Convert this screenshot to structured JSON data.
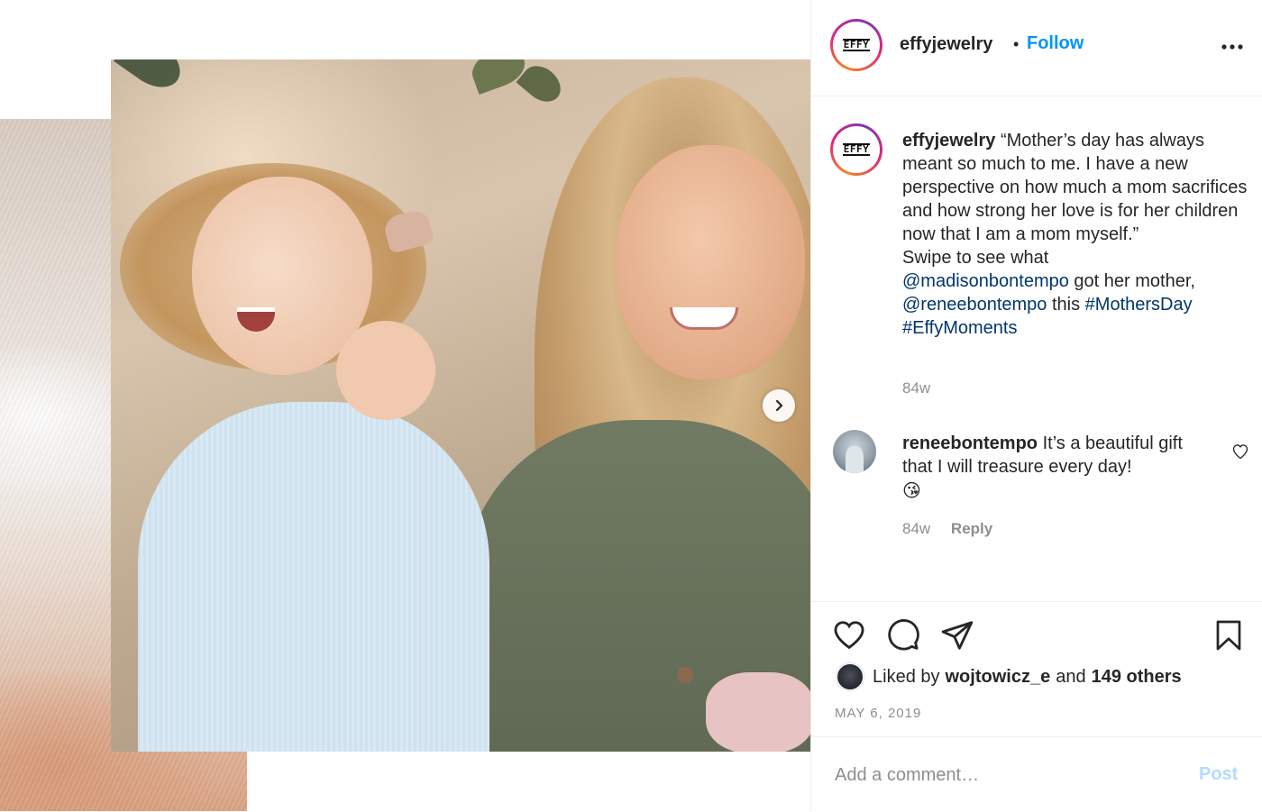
{
  "colors": {
    "link": "#00376b",
    "follow": "#0095f6",
    "post_disabled": "#b3dbff",
    "muted": "#8e8e8e",
    "text": "#262626"
  },
  "post": {
    "image_alt": "Toddler with pigtails looking up beside a smiling mother with long blonde hair"
  },
  "header": {
    "username": "effyjewelry",
    "separator": "•",
    "follow_label": "Follow",
    "avatar_logo": "EFFY",
    "more_icon": "more-horizontal-icon"
  },
  "caption": {
    "username": "effyjewelry",
    "text_1": "“Mother’s day has always meant so much to me. I have a new perspective on how much a mom sacrifices and how strong her love is for her children now that I am a mom myself.”",
    "text_2": "Swipe to see what",
    "mention_1": "@madisonbontempo",
    "text_3": "got her mother,",
    "mention_2": "@reneebontempo",
    "text_4": "this",
    "hashtag_1": "#MothersDay",
    "hashtag_2": "#EffyMoments",
    "time": "84w"
  },
  "comment": {
    "username": "reneebontempo",
    "text": "It’s a beautiful gift that I will treasure every day!",
    "emoji": "😘",
    "time": "84w",
    "reply_label": "Reply"
  },
  "actions": {
    "like_icon": "heart-icon",
    "comment_icon": "comment-icon",
    "share_icon": "send-icon",
    "save_icon": "bookmark-icon"
  },
  "likes": {
    "prefix": "Liked by",
    "user": "wojtowicz_e",
    "conj": "and",
    "others": "149 others"
  },
  "date": "MAY 6, 2019",
  "add_comment": {
    "placeholder": "Add a comment…",
    "post_label": "Post"
  }
}
